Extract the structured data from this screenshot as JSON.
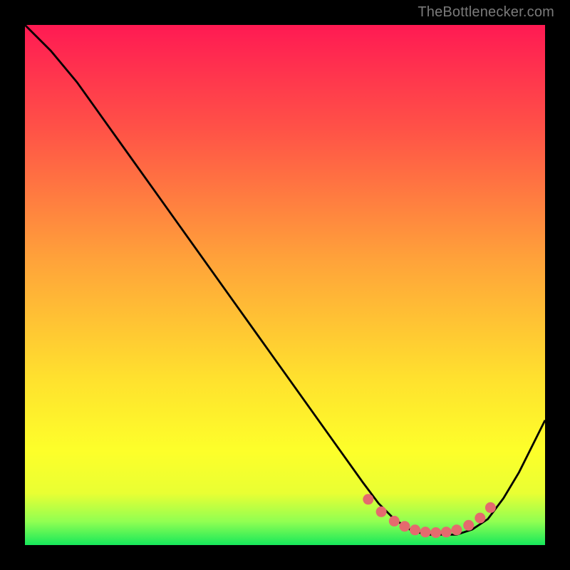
{
  "attribution": "TheBottlenecker.com",
  "colors": {
    "bg": "#000000",
    "curve": "#000000",
    "marker": "#e46a6e",
    "gradient_stops": [
      {
        "offset": 0,
        "color": "#ff1a53"
      },
      {
        "offset": 0.2,
        "color": "#ff5247"
      },
      {
        "offset": 0.45,
        "color": "#ffa23a"
      },
      {
        "offset": 0.68,
        "color": "#ffe12e"
      },
      {
        "offset": 0.82,
        "color": "#fdff2a"
      },
      {
        "offset": 0.9,
        "color": "#e9ff33"
      },
      {
        "offset": 0.955,
        "color": "#90ff52"
      },
      {
        "offset": 1.0,
        "color": "#16e85b"
      }
    ]
  },
  "chart_data": {
    "type": "line",
    "title": "",
    "xlabel": "",
    "ylabel": "",
    "xlim": [
      0,
      100
    ],
    "ylim": [
      0,
      100
    ],
    "series": [
      {
        "name": "curve",
        "x": [
          0,
          5,
          10,
          15,
          20,
          25,
          30,
          35,
          40,
          45,
          50,
          55,
          60,
          65,
          68,
          71,
          74,
          77,
          80,
          83,
          86,
          89,
          92,
          95,
          100
        ],
        "y": [
          100,
          95,
          89,
          82,
          75,
          68,
          61,
          54,
          47,
          40,
          33,
          26,
          19,
          12,
          8,
          5,
          3,
          2,
          2,
          2,
          3,
          5,
          9,
          14,
          24
        ]
      }
    ],
    "markers": {
      "name": "optimal-range",
      "x": [
        66,
        68.5,
        71,
        73,
        75,
        77,
        79,
        81,
        83,
        85.3,
        87.5,
        89.5
      ],
      "y": [
        8.8,
        6.4,
        4.6,
        3.6,
        2.9,
        2.5,
        2.4,
        2.5,
        2.9,
        3.8,
        5.2,
        7.2
      ]
    }
  }
}
